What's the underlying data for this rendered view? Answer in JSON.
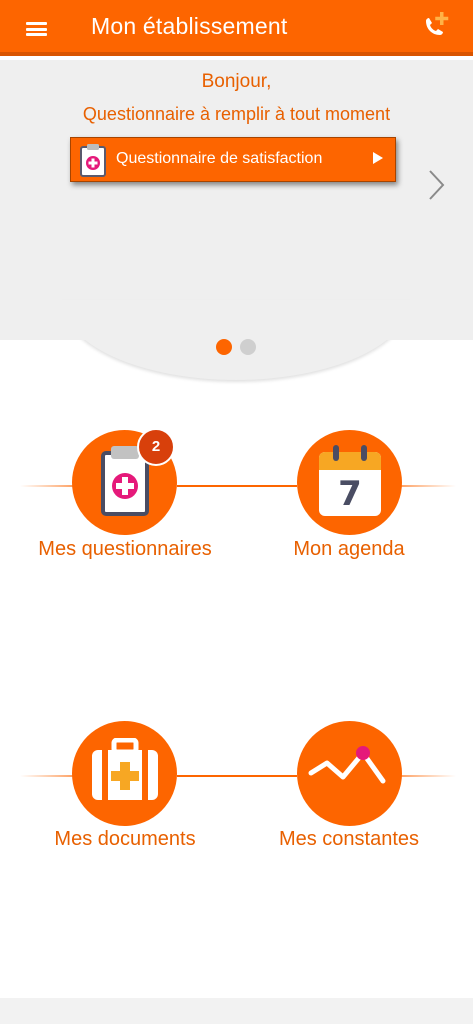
{
  "header": {
    "title": "Mon établissement",
    "menu_icon": "hamburger-menu-icon",
    "call_icon": "phone-add-icon"
  },
  "banner": {
    "greeting": "Bonjour,",
    "subtitle": "Questionnaire à remplir à tout moment",
    "button_label": "Questionnaire de satisfaction",
    "carousel_page": 1,
    "carousel_total": 2
  },
  "tiles": {
    "questionnaires": {
      "label": "Mes questionnaires",
      "badge": "2"
    },
    "agenda": {
      "label": "Mon agenda",
      "day": "7"
    },
    "documents": {
      "label": "Mes documents"
    },
    "constantes": {
      "label": "Mes constantes"
    }
  },
  "colors": {
    "brand_orange": "#fd6500",
    "badge_red": "#d8400b",
    "banner_gray": "#efefef"
  }
}
